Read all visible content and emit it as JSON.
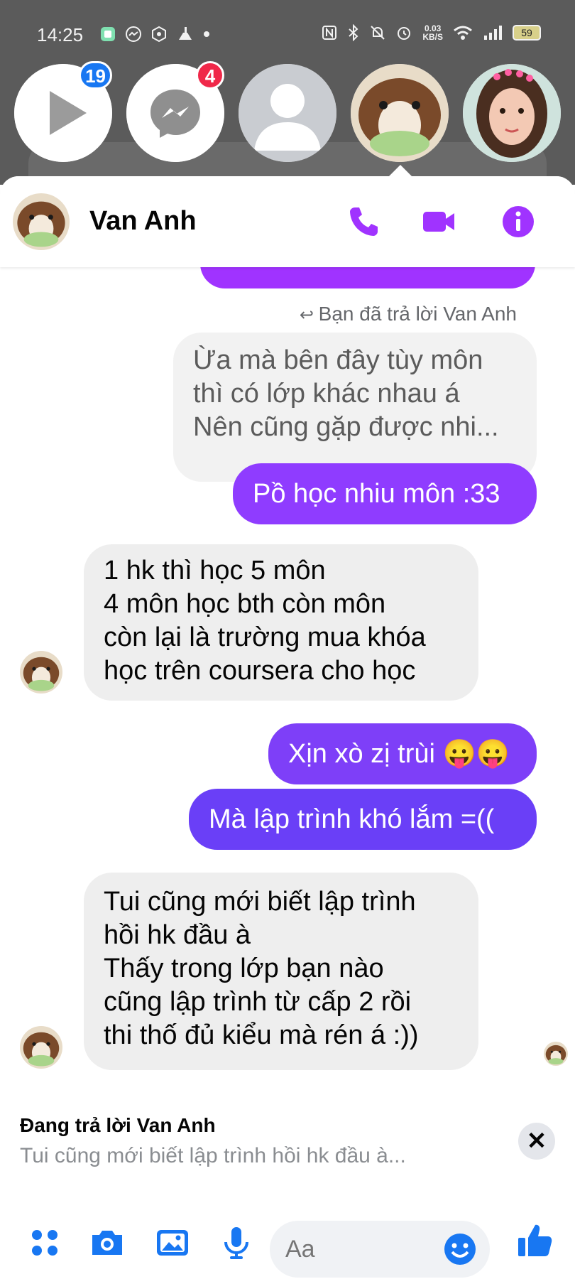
{
  "status_bar": {
    "time": "14:25",
    "net_speed": "0.03",
    "net_unit": "KB/S",
    "battery": "59"
  },
  "chat_heads": {
    "video_badge": "19",
    "messenger_badge": "4"
  },
  "header": {
    "contact_name": "Van Anh"
  },
  "conversation": {
    "reply_note": "Bạn đã trả lời Van Anh",
    "quoted_message": "Ừa mà bên đây tùy môn\nthì có lớp khác nhau á\nNên cũng gặp được nhi...",
    "messages": [
      {
        "sender": "me",
        "text": "Pồ học nhiu môn :33"
      },
      {
        "sender": "them",
        "text": "1 hk thì học 5 môn\n4 môn học bth còn môn\ncòn lại là trường mua khóa\nhọc trên coursera cho học"
      },
      {
        "sender": "me",
        "text": "Xịn xò zị trùi 😛😛"
      },
      {
        "sender": "me",
        "text": "Mà lập trình khó lắm =(("
      },
      {
        "sender": "them",
        "text": "Tui cũng mới biết lập trình\nhồi hk đầu à\nThấy trong lớp bạn nào\ncũng lập trình từ cấp 2 rồi\nthi thố đủ kiểu mà rén á :))"
      }
    ]
  },
  "reply": {
    "title_prefix": "Đang trả lời",
    "title_name": "Van Anh",
    "snippet": "Tui cũng mới biết lập trình hồi hk đầu à...",
    "close_symbol": "✕"
  },
  "composer": {
    "placeholder": "Aa"
  },
  "colors": {
    "accent": "#a033ff",
    "bubble_purple": "#8f3cff",
    "bubble_violet": "#6a3ff7",
    "messenger_blue": "#1877f2"
  }
}
